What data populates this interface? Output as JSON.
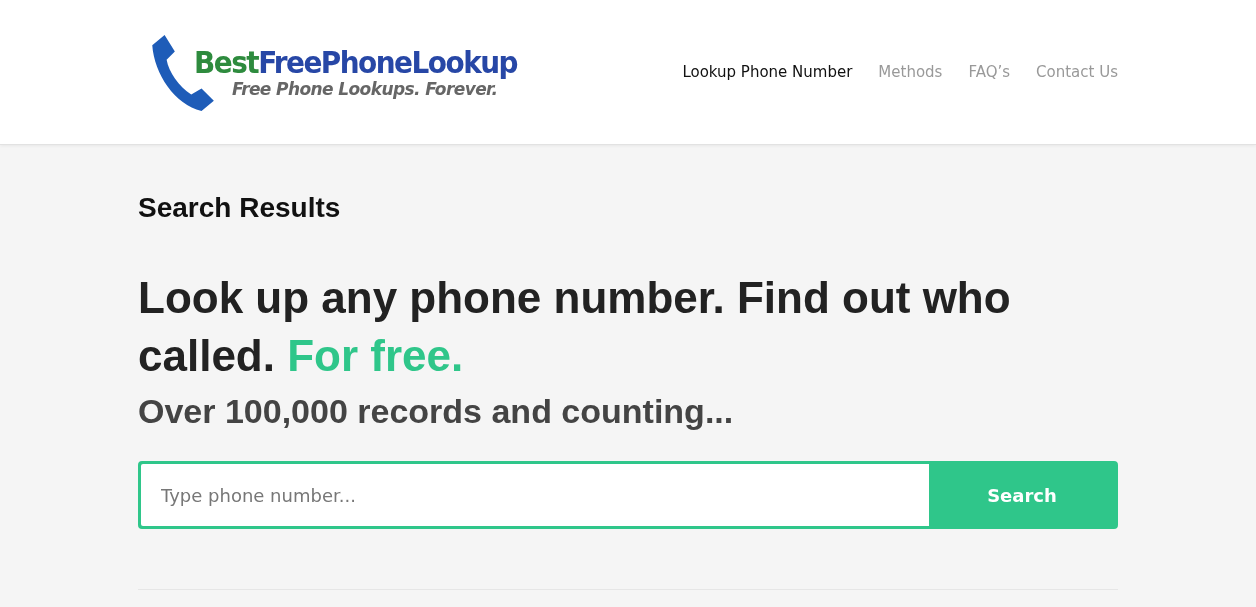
{
  "logo": {
    "wordmark": [
      {
        "text": "Best",
        "color": "#2e8b3e"
      },
      {
        "text": "FreePhoneLookup",
        "color": "#2747a6"
      }
    ],
    "tagline": "Free Phone Lookups. Forever."
  },
  "nav": [
    {
      "label": "Lookup Phone Number",
      "selected": true
    },
    {
      "label": "Methods",
      "selected": false
    },
    {
      "label": "FAQ’s",
      "selected": false
    },
    {
      "label": "Contact Us",
      "selected": false
    }
  ],
  "page_title": "Search Results",
  "headline": {
    "text": "Look up any phone number. Find out who called.",
    "highlight": "For free."
  },
  "subheadline": "Over 100,000 records and counting...",
  "search": {
    "placeholder": "Type phone number...",
    "button": "Search"
  }
}
